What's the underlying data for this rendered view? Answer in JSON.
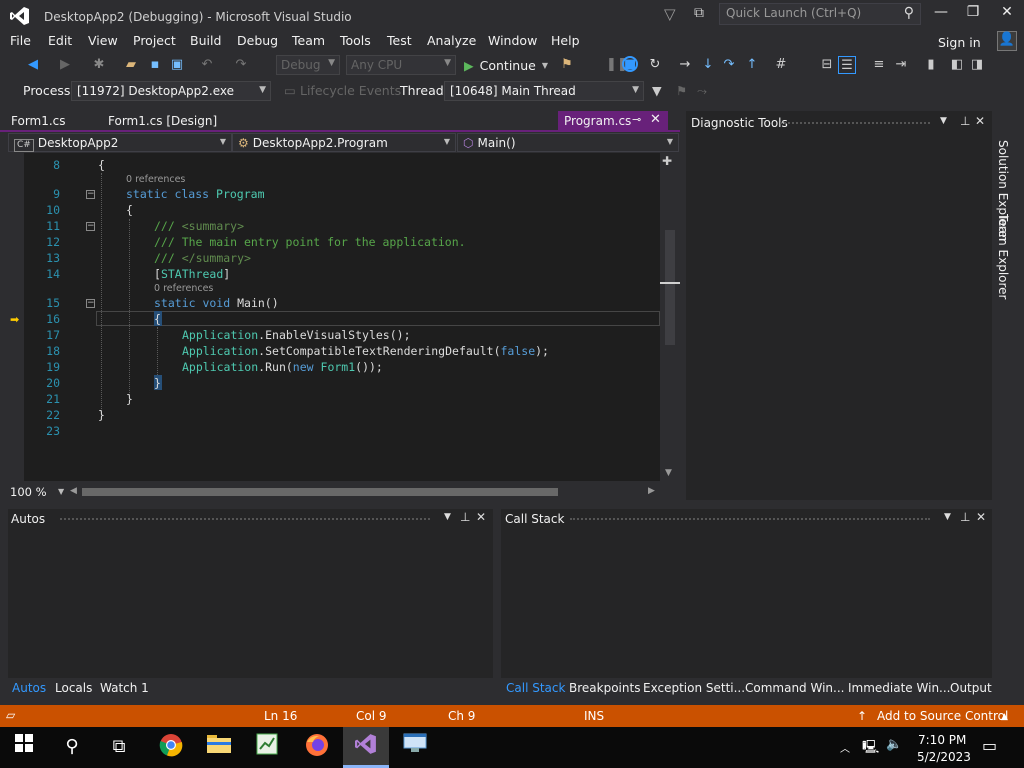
{
  "window": {
    "title": "DesktopApp2 (Debugging) - Microsoft Visual Studio",
    "quick_launch_placeholder": "Quick Launch (Ctrl+Q)"
  },
  "menu": [
    "File",
    "Edit",
    "View",
    "Project",
    "Build",
    "Debug",
    "Team",
    "Tools",
    "Test",
    "Analyze",
    "Window",
    "Help"
  ],
  "signin": "Sign in",
  "toolbar": {
    "config": "Debug",
    "platform": "Any CPU",
    "continue_label": "Continue"
  },
  "debug_location": {
    "process_label": "Process:",
    "process_value": "[11972] DesktopApp2.exe",
    "lifecycle_label": "Lifecycle Events",
    "thread_label": "Thread:",
    "thread_value": "[10648] Main Thread"
  },
  "doc_tabs": [
    "Form1.cs",
    "Form1.cs [Design]",
    "Program.cs"
  ],
  "nav": {
    "project": "DesktopApp2",
    "type": "DesktopApp2.Program",
    "member": "Main()"
  },
  "code": {
    "line_numbers": [
      "8",
      "9",
      "10",
      "11",
      "12",
      "13",
      "14",
      "15",
      "16",
      "17",
      "18",
      "19",
      "20",
      "21",
      "22",
      "23"
    ],
    "codelens": "0 references",
    "lines": {
      "l8": "{",
      "l9_kw": "static class",
      "l9_ty": "Program",
      "l10": "{",
      "l11_prefix": "///",
      "l11_tag": "<summary>",
      "l12": "/// The main entry point for the application.",
      "l13_prefix": "///",
      "l13_tag": "</summary>",
      "l14_open": "[",
      "l14_attr": "STAThread",
      "l14_close": "]",
      "l15_kw": "static void",
      "l15_rest": "Main()",
      "l16": "{",
      "l17_ty": "Application",
      "l17_rest": ".EnableVisualStyles();",
      "l18_ty": "Application",
      "l18_mid": ".SetCompatibleTextRenderingDefault(",
      "l18_kw": "false",
      "l18_end": ");",
      "l19_ty": "Application",
      "l19_mid": ".Run(",
      "l19_kw": "new",
      "l19_ty2": "Form1",
      "l19_end": "());",
      "l20": "}",
      "l21": "}",
      "l22": "}"
    },
    "zoom": "100 %"
  },
  "diagnostic_tools": {
    "title": "Diagnostic Tools"
  },
  "side_tabs": [
    "Solution Explorer",
    "Team Explorer"
  ],
  "autos_pane": {
    "title": "Autos",
    "tabs": [
      "Autos",
      "Locals",
      "Watch 1"
    ]
  },
  "callstack_pane": {
    "title": "Call Stack",
    "tabs": [
      "Call Stack",
      "Breakpoints",
      "Exception Setti...",
      "Command Win...",
      "Immediate Win...",
      "Output"
    ]
  },
  "status": {
    "ln": "Ln 16",
    "col": "Col 9",
    "ch": "Ch 9",
    "ins": "INS",
    "source_control": "Add to Source Control"
  },
  "taskbar": {
    "time": "7:10 PM",
    "date": "5/2/2023"
  },
  "colors": {
    "accent_purple": "#68217a",
    "status_orange": "#ca5100",
    "line_number": "#2b91af",
    "keyword": "#569cd6",
    "type": "#4ec9b0",
    "comment": "#57a64a"
  }
}
